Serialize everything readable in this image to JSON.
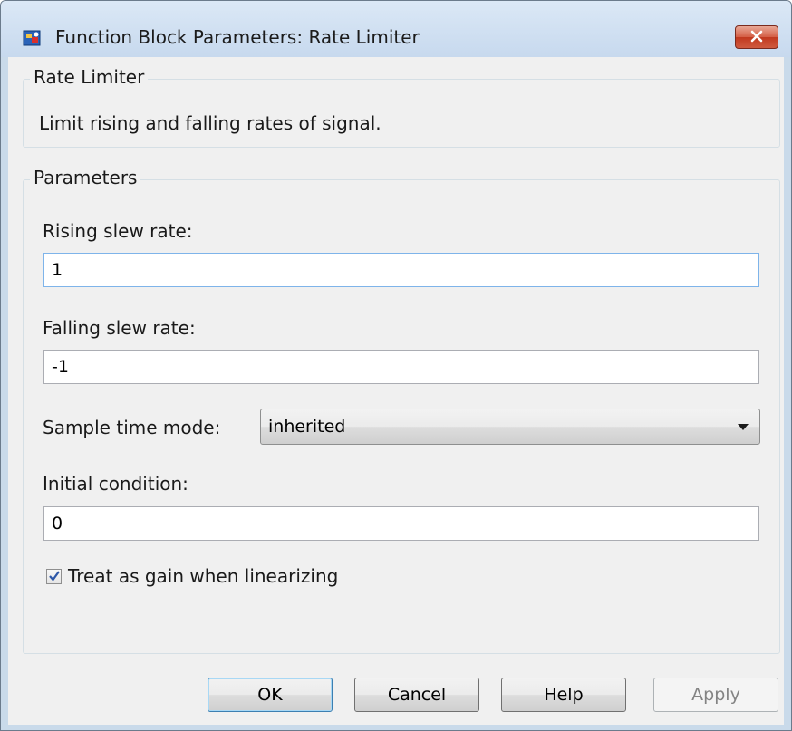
{
  "window": {
    "title": "Function Block Parameters: Rate Limiter",
    "icon": "simulink-block-icon",
    "close_icon": "close-icon"
  },
  "description_group": {
    "legend": "Rate Limiter",
    "text": "Limit rising and falling rates of signal."
  },
  "parameters_group": {
    "legend": "Parameters",
    "rising_label": "Rising slew rate:",
    "rising_value": "1",
    "falling_label": "Falling slew rate:",
    "falling_value": "-1",
    "sample_time_label": "Sample time mode:",
    "sample_time_value": "inherited",
    "initial_label": "Initial condition:",
    "initial_value": "0",
    "linearize_label": "Treat as gain when linearizing",
    "linearize_checked": true
  },
  "buttons": {
    "ok": "OK",
    "cancel": "Cancel",
    "help": "Help",
    "apply": "Apply"
  },
  "colors": {
    "title_bar": "#c7d9ee",
    "close_button": "#c1391f",
    "dialog_background": "#f0f0f0",
    "focus_border": "#7eb4ea"
  }
}
